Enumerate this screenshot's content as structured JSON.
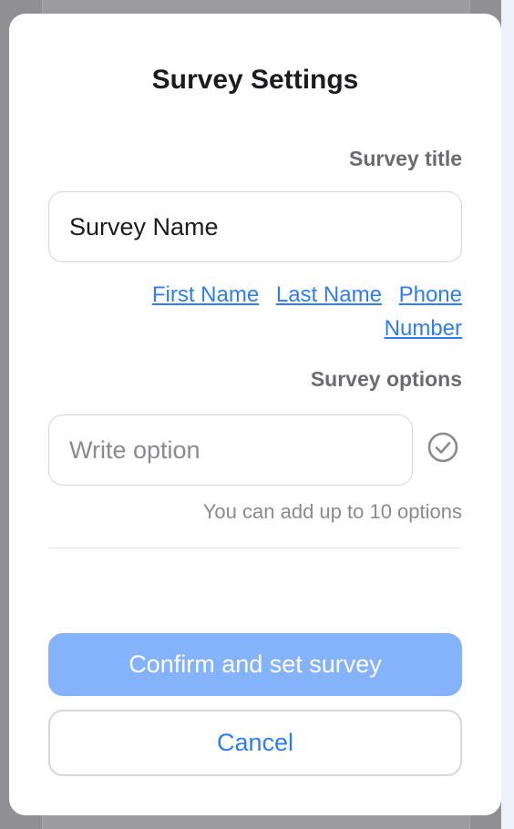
{
  "modal": {
    "title": "Survey Settings"
  },
  "survey_title": {
    "label": "Survey title",
    "value": "Survey Name",
    "tokens": [
      "First Name",
      "Last Name",
      "Phone Number"
    ]
  },
  "survey_options": {
    "label": "Survey options",
    "placeholder": "Write option",
    "confirm_icon": "check-circle-icon",
    "hint": "You can add up to 10 options"
  },
  "actions": {
    "confirm_label": "Confirm and set survey",
    "cancel_label": "Cancel"
  },
  "colors": {
    "accent": "#2f7df6",
    "confirm_disabled_bg": "#84b2fb",
    "overlay": "#8f8f94"
  }
}
